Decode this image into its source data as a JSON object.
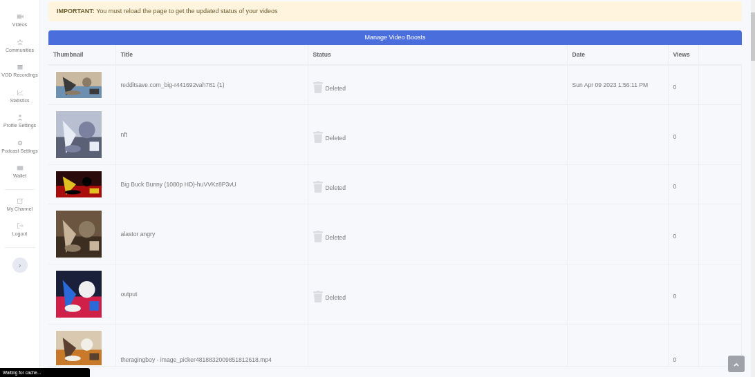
{
  "sidebar": {
    "items": [
      {
        "label": "Videos"
      },
      {
        "label": "Communities"
      },
      {
        "label": "VOD Recordings"
      },
      {
        "label": "Statistics"
      },
      {
        "label": "Profile Settings"
      },
      {
        "label": "Podcast Settings"
      },
      {
        "label": "Wallet"
      }
    ],
    "bottom_items": [
      {
        "label": "My Channel"
      },
      {
        "label": "Logout"
      }
    ],
    "toggle": "›"
  },
  "alert": {
    "strong": "IMPORTANT:",
    "text": "You must reload the page to get the updated status of your videos"
  },
  "manage_button": "Manage Video Boosts",
  "table": {
    "columns": [
      "Thumbnail",
      "Title",
      "Status",
      "Date",
      "Views"
    ],
    "rows": [
      {
        "title": "redditsave.com_big-r441692vah781 (1)",
        "status": "Deleted",
        "date": "Sun Apr 09 2023 1:56:11 PM",
        "views": "0"
      },
      {
        "title": "nft",
        "status": "Deleted",
        "views": "0"
      },
      {
        "title": "Big Buck Bunny (1080p HD)-huVVKz8P3vU",
        "status": "Deleted",
        "views": "0"
      },
      {
        "title": "alastor angry",
        "status": "Deleted",
        "views": "0"
      },
      {
        "title": "output",
        "status": "Deleted",
        "views": "0"
      },
      {
        "title": "theragingboy - image_picker4818832009851812618.mp4",
        "views": "0"
      }
    ]
  },
  "status_bar": "Waiting for cache..."
}
